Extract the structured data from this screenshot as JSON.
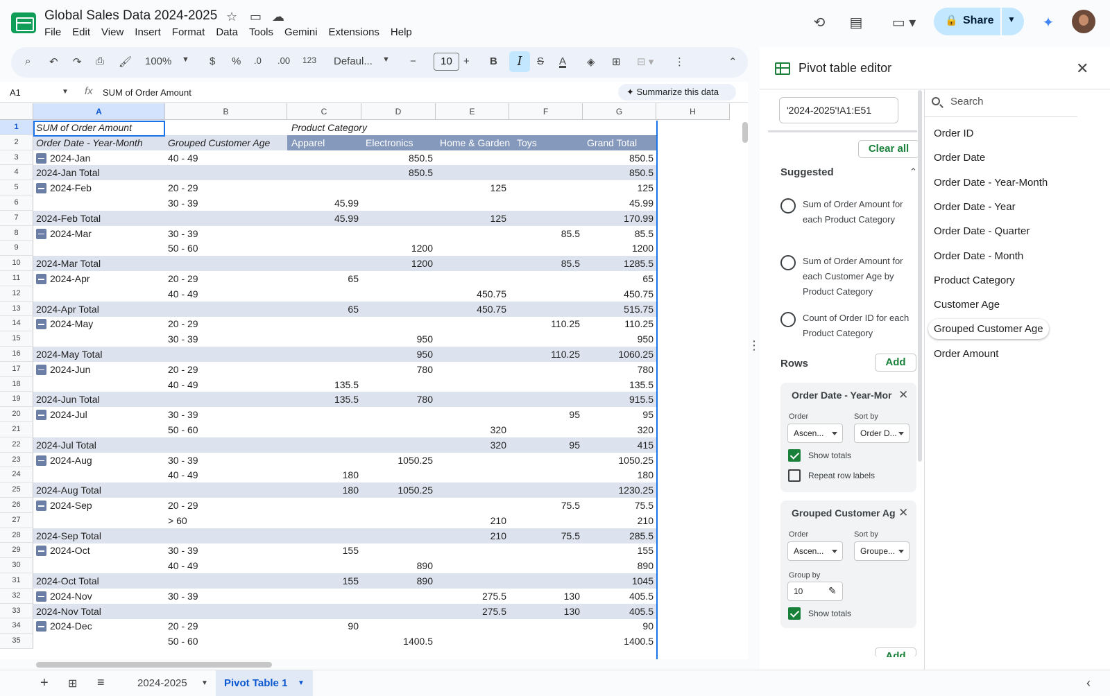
{
  "header": {
    "doc_title": "Global Sales Data 2024-2025",
    "menu": [
      "File",
      "Edit",
      "View",
      "Insert",
      "Format",
      "Data",
      "Tools",
      "Gemini",
      "Extensions",
      "Help"
    ],
    "share_label": "Share"
  },
  "toolbar": {
    "zoom": "100%",
    "currency": "$",
    "percent": "%",
    "dec_dec": ".0",
    "inc_dec": ".00",
    "number_format": "123",
    "font": "Defaul...",
    "font_size": "10",
    "bold": "B",
    "italic": "I",
    "strike": "S",
    "text_color": "A"
  },
  "formula_bar": {
    "cell_ref": "A1",
    "fx": "fx",
    "content": "SUM of Order Amount",
    "summarize_label": "Summarize this data"
  },
  "columns": [
    "A",
    "B",
    "C",
    "D",
    "E",
    "F",
    "G",
    "H"
  ],
  "rows": [
    {
      "n": "1",
      "a": "SUM of Order Amount",
      "b": "",
      "c": "Product Category",
      "d": "",
      "e": "",
      "f": "",
      "g": "",
      "type": "top"
    },
    {
      "n": "2",
      "a": "Order Date - Year-Month",
      "b": "Grouped Customer Age",
      "c": "Apparel",
      "d": "Electronics",
      "e": "Home & Garden",
      "f": "Toys",
      "g": "Grand Total",
      "type": "head"
    },
    {
      "n": "3",
      "a": "2024-Jan",
      "b": "40 - 49",
      "c": "",
      "d": "850.5",
      "e": "",
      "f": "",
      "g": "850.5",
      "type": "group"
    },
    {
      "n": "4",
      "a": "2024-Jan Total",
      "b": "",
      "c": "",
      "d": "850.5",
      "e": "",
      "f": "",
      "g": "850.5",
      "type": "total"
    },
    {
      "n": "5",
      "a": "2024-Feb",
      "b": "20 - 29",
      "c": "",
      "d": "",
      "e": "125",
      "f": "",
      "g": "125",
      "type": "group"
    },
    {
      "n": "6",
      "a": "",
      "b": "30 - 39",
      "c": "45.99",
      "d": "",
      "e": "",
      "f": "",
      "g": "45.99",
      "type": "data"
    },
    {
      "n": "7",
      "a": "2024-Feb Total",
      "b": "",
      "c": "45.99",
      "d": "",
      "e": "125",
      "f": "",
      "g": "170.99",
      "type": "total"
    },
    {
      "n": "8",
      "a": "2024-Mar",
      "b": "30 - 39",
      "c": "",
      "d": "",
      "e": "",
      "f": "85.5",
      "g": "85.5",
      "type": "group"
    },
    {
      "n": "9",
      "a": "",
      "b": "50 - 60",
      "c": "",
      "d": "1200",
      "e": "",
      "f": "",
      "g": "1200",
      "type": "data"
    },
    {
      "n": "10",
      "a": "2024-Mar Total",
      "b": "",
      "c": "",
      "d": "1200",
      "e": "",
      "f": "85.5",
      "g": "1285.5",
      "type": "total"
    },
    {
      "n": "11",
      "a": "2024-Apr",
      "b": "20 - 29",
      "c": "65",
      "d": "",
      "e": "",
      "f": "",
      "g": "65",
      "type": "group"
    },
    {
      "n": "12",
      "a": "",
      "b": "40 - 49",
      "c": "",
      "d": "",
      "e": "450.75",
      "f": "",
      "g": "450.75",
      "type": "data"
    },
    {
      "n": "13",
      "a": "2024-Apr Total",
      "b": "",
      "c": "65",
      "d": "",
      "e": "450.75",
      "f": "",
      "g": "515.75",
      "type": "total"
    },
    {
      "n": "14",
      "a": "2024-May",
      "b": "20 - 29",
      "c": "",
      "d": "",
      "e": "",
      "f": "110.25",
      "g": "110.25",
      "type": "group"
    },
    {
      "n": "15",
      "a": "",
      "b": "30 - 39",
      "c": "",
      "d": "950",
      "e": "",
      "f": "",
      "g": "950",
      "type": "data"
    },
    {
      "n": "16",
      "a": "2024-May Total",
      "b": "",
      "c": "",
      "d": "950",
      "e": "",
      "f": "110.25",
      "g": "1060.25",
      "type": "total"
    },
    {
      "n": "17",
      "a": "2024-Jun",
      "b": "20 - 29",
      "c": "",
      "d": "780",
      "e": "",
      "f": "",
      "g": "780",
      "type": "group"
    },
    {
      "n": "18",
      "a": "",
      "b": "40 - 49",
      "c": "135.5",
      "d": "",
      "e": "",
      "f": "",
      "g": "135.5",
      "type": "data"
    },
    {
      "n": "19",
      "a": "2024-Jun Total",
      "b": "",
      "c": "135.5",
      "d": "780",
      "e": "",
      "f": "",
      "g": "915.5",
      "type": "total"
    },
    {
      "n": "20",
      "a": "2024-Jul",
      "b": "30 - 39",
      "c": "",
      "d": "",
      "e": "",
      "f": "95",
      "g": "95",
      "type": "group"
    },
    {
      "n": "21",
      "a": "",
      "b": "50 - 60",
      "c": "",
      "d": "",
      "e": "320",
      "f": "",
      "g": "320",
      "type": "data"
    },
    {
      "n": "22",
      "a": "2024-Jul Total",
      "b": "",
      "c": "",
      "d": "",
      "e": "320",
      "f": "95",
      "g": "415",
      "type": "total"
    },
    {
      "n": "23",
      "a": "2024-Aug",
      "b": "30 - 39",
      "c": "",
      "d": "1050.25",
      "e": "",
      "f": "",
      "g": "1050.25",
      "type": "group"
    },
    {
      "n": "24",
      "a": "",
      "b": "40 - 49",
      "c": "180",
      "d": "",
      "e": "",
      "f": "",
      "g": "180",
      "type": "data"
    },
    {
      "n": "25",
      "a": "2024-Aug Total",
      "b": "",
      "c": "180",
      "d": "1050.25",
      "e": "",
      "f": "",
      "g": "1230.25",
      "type": "total"
    },
    {
      "n": "26",
      "a": "2024-Sep",
      "b": "20 - 29",
      "c": "",
      "d": "",
      "e": "",
      "f": "75.5",
      "g": "75.5",
      "type": "group"
    },
    {
      "n": "27",
      "a": "",
      "b": "> 60",
      "c": "",
      "d": "",
      "e": "210",
      "f": "",
      "g": "210",
      "type": "data"
    },
    {
      "n": "28",
      "a": "2024-Sep Total",
      "b": "",
      "c": "",
      "d": "",
      "e": "210",
      "f": "75.5",
      "g": "285.5",
      "type": "total"
    },
    {
      "n": "29",
      "a": "2024-Oct",
      "b": "30 - 39",
      "c": "155",
      "d": "",
      "e": "",
      "f": "",
      "g": "155",
      "type": "group"
    },
    {
      "n": "30",
      "a": "",
      "b": "40 - 49",
      "c": "",
      "d": "890",
      "e": "",
      "f": "",
      "g": "890",
      "type": "data"
    },
    {
      "n": "31",
      "a": "2024-Oct Total",
      "b": "",
      "c": "155",
      "d": "890",
      "e": "",
      "f": "",
      "g": "1045",
      "type": "total"
    },
    {
      "n": "32",
      "a": "2024-Nov",
      "b": "30 - 39",
      "c": "",
      "d": "",
      "e": "275.5",
      "f": "130",
      "g": "405.5",
      "type": "group"
    },
    {
      "n": "33",
      "a": "2024-Nov Total",
      "b": "",
      "c": "",
      "d": "",
      "e": "275.5",
      "f": "130",
      "g": "405.5",
      "type": "total"
    },
    {
      "n": "34",
      "a": "2024-Dec",
      "b": "20 - 29",
      "c": "90",
      "d": "",
      "e": "",
      "f": "",
      "g": "90",
      "type": "group"
    },
    {
      "n": "35",
      "a": "",
      "b": "50 - 60",
      "c": "",
      "d": "1400.5",
      "e": "",
      "f": "",
      "g": "1400.5",
      "type": "data"
    }
  ],
  "sheets": {
    "tab1": "2024-2025",
    "tab2": "Pivot Table 1"
  },
  "editor": {
    "title": "Pivot table editor",
    "range": "'2024-2025'!A1:E51",
    "clear_all": "Clear all",
    "suggested": "Suggested",
    "suggestions": [
      "Sum of Order Amount for each Product Category",
      "Sum of Order Amount for each Customer Age by Product Category",
      "Count of Order ID for each Product Category"
    ],
    "rows_label": "Rows",
    "add": "Add",
    "card1": {
      "title": "Order Date - Year-Mor",
      "order_label": "Order",
      "order_value": "Ascen...",
      "sort_label": "Sort by",
      "sort_value": "Order D...",
      "show_totals": "Show totals",
      "repeat_labels": "Repeat row labels"
    },
    "card2": {
      "title": "Grouped Customer Ag",
      "order_label": "Order",
      "order_value": "Ascen...",
      "sort_label": "Sort by",
      "sort_value": "Groupe...",
      "group_by_label": "Group by",
      "group_by_value": "10",
      "show_totals": "Show totals"
    },
    "search_placeholder": "Search",
    "fields": [
      "Order ID",
      "Order Date",
      "Order Date - Year-Month",
      "Order Date - Year",
      "Order Date - Quarter",
      "Order Date - Month",
      "Product Category",
      "Customer Age",
      "Grouped Customer Age",
      "Order Amount"
    ],
    "highlighted_field": "Grouped Customer Age"
  },
  "colors": {
    "accent": "#1a73e8",
    "pivot_header": "#8599bd",
    "pivot_band": "#dde3ee",
    "green": "#188038",
    "share_bg": "#c2e7ff"
  }
}
